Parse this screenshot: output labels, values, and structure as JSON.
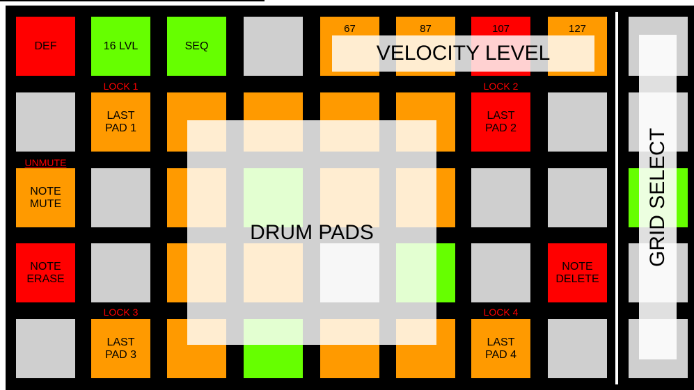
{
  "colors": {
    "gray": "#cfcfcf",
    "orange": "#ff9a00",
    "red": "#ff0000",
    "green": "#66ff00",
    "lock_text": "#ff0000"
  },
  "top_row": {
    "def": "DEF",
    "lvl": "16 LVL",
    "seq": "SEQ",
    "vel_values": [
      "67",
      "87",
      "107",
      "127"
    ]
  },
  "locks": {
    "lock1": "LOCK 1",
    "lock2": "LOCK 2",
    "lock3": "LOCK 3",
    "lock4": "LOCK 4"
  },
  "pads": {
    "last_pad_1": [
      "LAST",
      "PAD 1"
    ],
    "last_pad_2": [
      "LAST",
      "PAD 2"
    ],
    "last_pad_3": [
      "LAST",
      "PAD 3"
    ],
    "last_pad_4": [
      "LAST",
      "PAD 4"
    ],
    "note_mute": [
      "NOTE",
      "MUTE"
    ],
    "note_erase": [
      "NOTE",
      "ERASE"
    ],
    "note_delete": [
      "NOTE",
      "DELETE"
    ]
  },
  "unmute_label": "UNMUTE",
  "overlays": {
    "velocity_level": "VELOCITY LEVEL",
    "drum_pads": "DRUM PADS",
    "grid_select": "GRID SELECT"
  }
}
